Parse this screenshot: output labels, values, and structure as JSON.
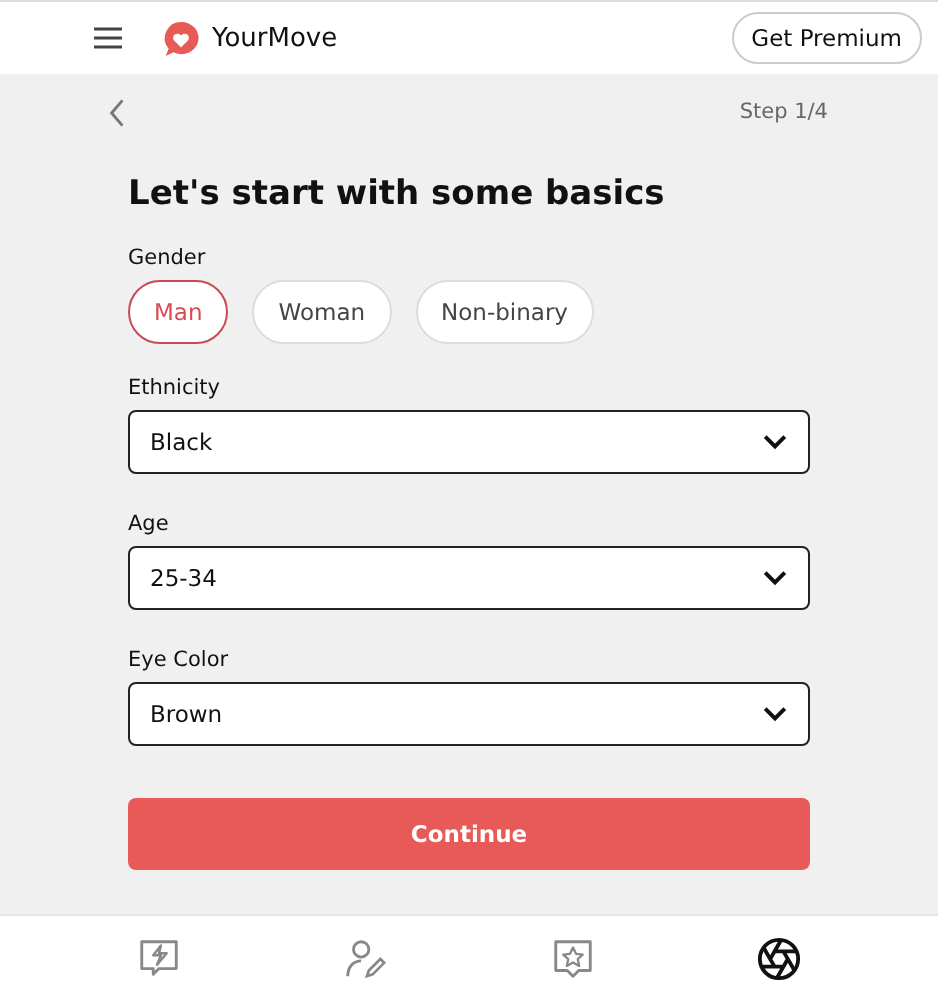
{
  "header": {
    "logo": "YourMove",
    "premium_button": "Get Premium"
  },
  "step": "Step 1/4",
  "title": "Let's start with some basics",
  "gender": {
    "label": "Gender",
    "options": [
      {
        "label": "Man",
        "selected": true
      },
      {
        "label": "Woman",
        "selected": false
      },
      {
        "label": "Non-binary",
        "selected": false
      }
    ]
  },
  "selects": [
    {
      "label": "Ethnicity",
      "value": "Black"
    },
    {
      "label": "Age",
      "value": "25-34"
    },
    {
      "label": "Eye Color",
      "value": "Brown"
    }
  ],
  "continue_button": "Continue",
  "bottom_nav": [
    {
      "kind": "bolt",
      "selected": false
    },
    {
      "kind": "profile",
      "selected": false
    },
    {
      "kind": "star",
      "selected": false
    },
    {
      "kind": "aperture",
      "selected": true
    }
  ]
}
